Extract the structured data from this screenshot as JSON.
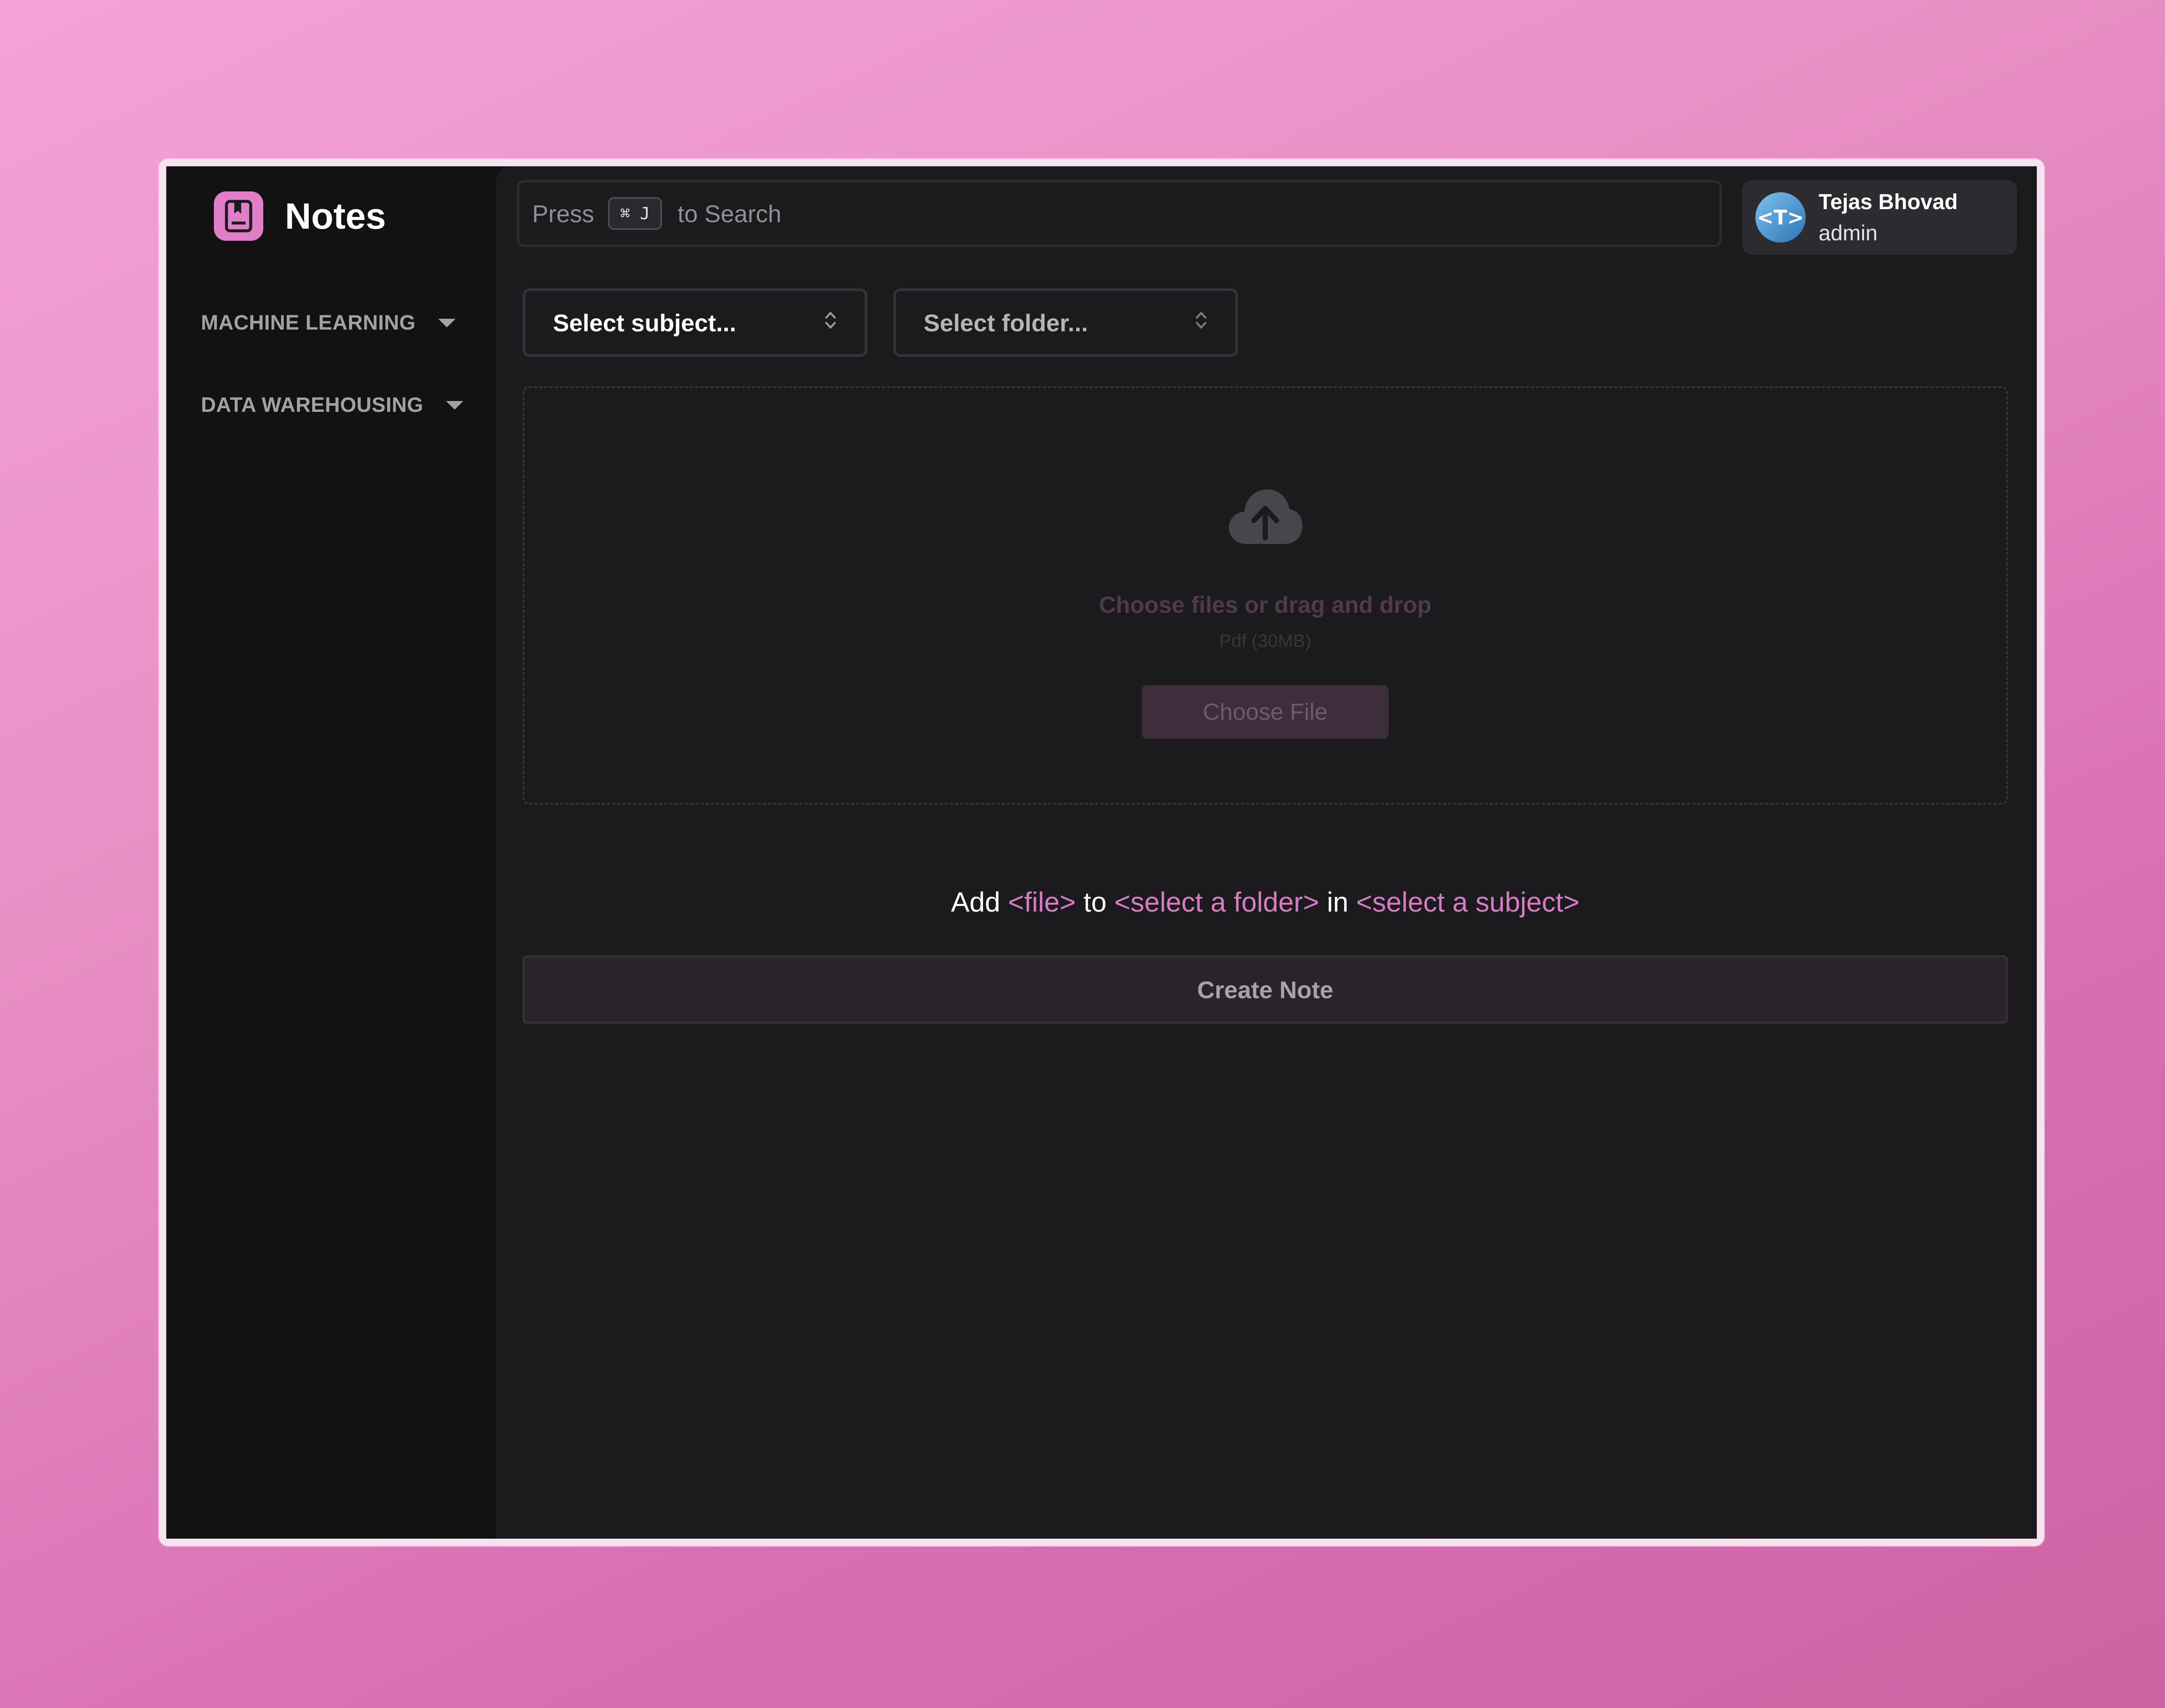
{
  "app": {
    "title": "Notes"
  },
  "sidebar": {
    "groups": [
      {
        "label": "MACHINE LEARNING"
      },
      {
        "label": "DATA WAREHOUSING"
      }
    ]
  },
  "search": {
    "prefix": "Press",
    "shortcut": "⌘ J",
    "suffix": "to Search"
  },
  "user": {
    "name": "Tejas Bhovad",
    "role": "admin",
    "avatar_text": "<T>"
  },
  "form": {
    "subject_placeholder": "Select subject...",
    "folder_placeholder": "Select folder...",
    "dropzone_title": "Choose files or drag and drop",
    "dropzone_hint": "Pdf (30MB)",
    "choose_file_label": "Choose File",
    "summary": {
      "add": "Add",
      "file": "<file>",
      "to": "to",
      "folder": "<select a folder>",
      "in": "in",
      "subject": "<select a subject>"
    },
    "create_label": "Create Note"
  },
  "icons": {
    "brand": "notebook-icon",
    "caret": "caret-down-icon",
    "chevrons": "chevron-up-down-icon",
    "upload": "cloud-upload-icon"
  },
  "colors": {
    "accent": "#d67bc4",
    "brand_logo": "#e07fc7",
    "background": "#1b1b1d",
    "sidebar": "#121213"
  }
}
